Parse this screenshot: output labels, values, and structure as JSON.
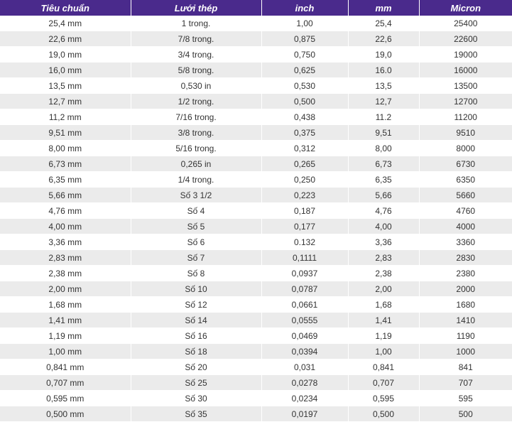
{
  "table": {
    "headers": [
      "Tiêu chuẩn",
      "Lưới thép",
      "inch",
      "mm",
      "Micron"
    ],
    "rows": [
      [
        "25,4 mm",
        "1 trong.",
        "1,00",
        "25,4",
        "25400"
      ],
      [
        "22,6 mm",
        "7/8 trong.",
        "0,875",
        "22,6",
        "22600"
      ],
      [
        "19,0 mm",
        "3/4 trong.",
        "0,750",
        "19,0",
        "19000"
      ],
      [
        "16,0 mm",
        "5/8 trong.",
        "0,625",
        "16.0",
        "16000"
      ],
      [
        "13,5 mm",
        "0,530 in",
        "0,530",
        "13,5",
        "13500"
      ],
      [
        "12,7 mm",
        "1/2 trong.",
        "0,500",
        "12,7",
        "12700"
      ],
      [
        "11,2 mm",
        "7/16 trong.",
        "0,438",
        "11.2",
        "11200"
      ],
      [
        "9,51 mm",
        "3/8 trong.",
        "0,375",
        "9,51",
        "9510"
      ],
      [
        "8,00 mm",
        "5/16 trong.",
        "0,312",
        "8,00",
        "8000"
      ],
      [
        "6,73 mm",
        "0,265 in",
        "0,265",
        "6,73",
        "6730"
      ],
      [
        "6,35 mm",
        "1/4 trong.",
        "0,250",
        "6,35",
        "6350"
      ],
      [
        "5,66 mm",
        "Số 3 1/2",
        "0,223",
        "5,66",
        "5660"
      ],
      [
        "4,76 mm",
        "Số 4",
        "0,187",
        "4,76",
        "4760"
      ],
      [
        "4,00 mm",
        "Số 5",
        "0,177",
        "4,00",
        "4000"
      ],
      [
        "3,36 mm",
        "Số 6",
        "0.132",
        "3,36",
        "3360"
      ],
      [
        "2,83 mm",
        "Số 7",
        "0,1111",
        "2,83",
        "2830"
      ],
      [
        "2,38 mm",
        "Số 8",
        "0,0937",
        "2,38",
        "2380"
      ],
      [
        "2,00 mm",
        "Số 10",
        "0,0787",
        "2,00",
        "2000"
      ],
      [
        "1,68 mm",
        "Số 12",
        "0,0661",
        "1,68",
        "1680"
      ],
      [
        "1,41 mm",
        "Số 14",
        "0,0555",
        "1,41",
        "1410"
      ],
      [
        "1,19 mm",
        "Số 16",
        "0,0469",
        "1,19",
        "1190"
      ],
      [
        "1,00 mm",
        "Số 18",
        "0,0394",
        "1,00",
        "1000"
      ],
      [
        "0,841 mm",
        "Số 20",
        "0,031",
        "0,841",
        "841"
      ],
      [
        "0,707 mm",
        "Số 25",
        "0,0278",
        "0,707",
        "707"
      ],
      [
        "0,595 mm",
        "Số 30",
        "0,0234",
        "0,595",
        "595"
      ],
      [
        "0,500 mm",
        "Số 35",
        "0,0197",
        "0,500",
        "500"
      ]
    ]
  }
}
